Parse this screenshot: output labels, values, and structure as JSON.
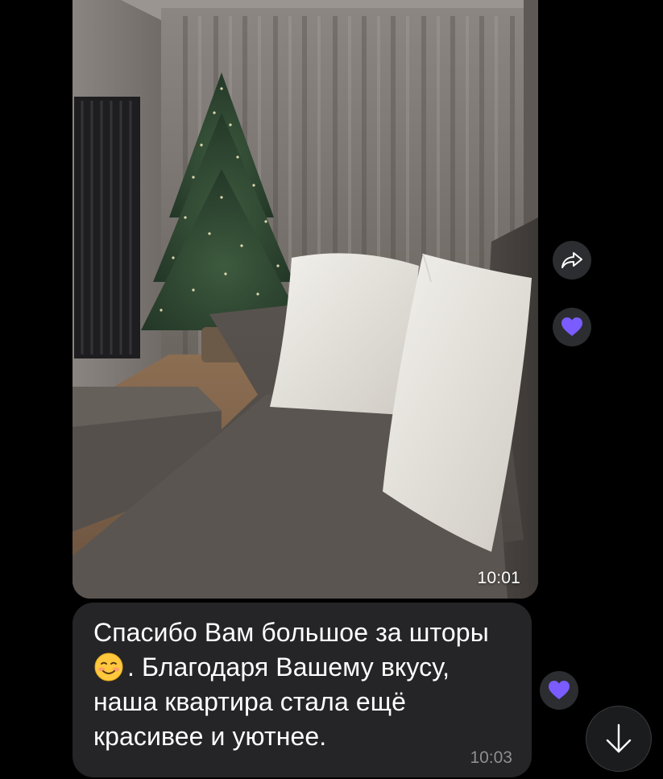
{
  "photo_message": {
    "time": "10:01"
  },
  "text_message": {
    "line1": "Спасибо Вам большое за шторы",
    "line2_after_emoji": ". Благодаря Вашему вкусу,",
    "line3": "наша квартира стала ещё",
    "line4": "красивее и уютнее.",
    "emoji": "smiling-face-emoji",
    "time": "10:03"
  },
  "icons": {
    "forward": "forward-arrow-icon",
    "reaction": "purple-heart-icon",
    "scroll_down": "arrow-down-icon"
  },
  "colors": {
    "background": "#000000",
    "bubble": "#252527",
    "heart": "#7a5cff",
    "circle": "#2c2d30"
  }
}
